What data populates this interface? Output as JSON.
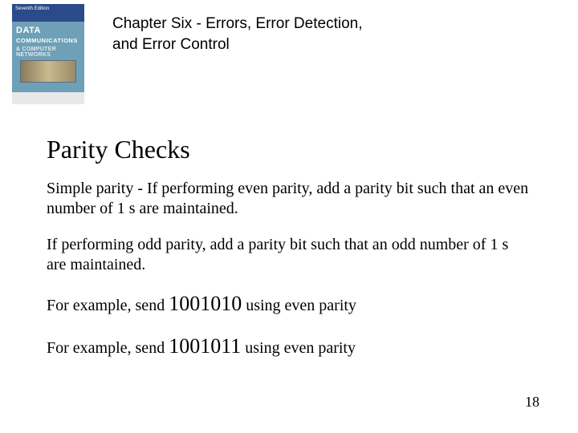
{
  "header": {
    "cover": {
      "top_label": "Seventh Edition",
      "title_line1": "DATA",
      "title_line2": "COMMUNICATIONS",
      "subtitle": "& COMPUTER NETWORKS"
    },
    "chapter_title": "Chapter Six - Errors, Error Detection, and Error Control"
  },
  "slide": {
    "title": "Parity Checks",
    "p1": "Simple parity - If performing even parity, add a parity bit such that an even number of 1 s are maintained.",
    "p2": "If performing odd parity, add a parity bit such that an odd number of 1 s are maintained.",
    "ex1_prefix": "For example, send ",
    "ex1_num": "1001010",
    "ex1_suffix": " using even parity",
    "ex2_prefix": "For example, send ",
    "ex2_num": "1001011",
    "ex2_suffix": " using even parity"
  },
  "page_number": "18"
}
